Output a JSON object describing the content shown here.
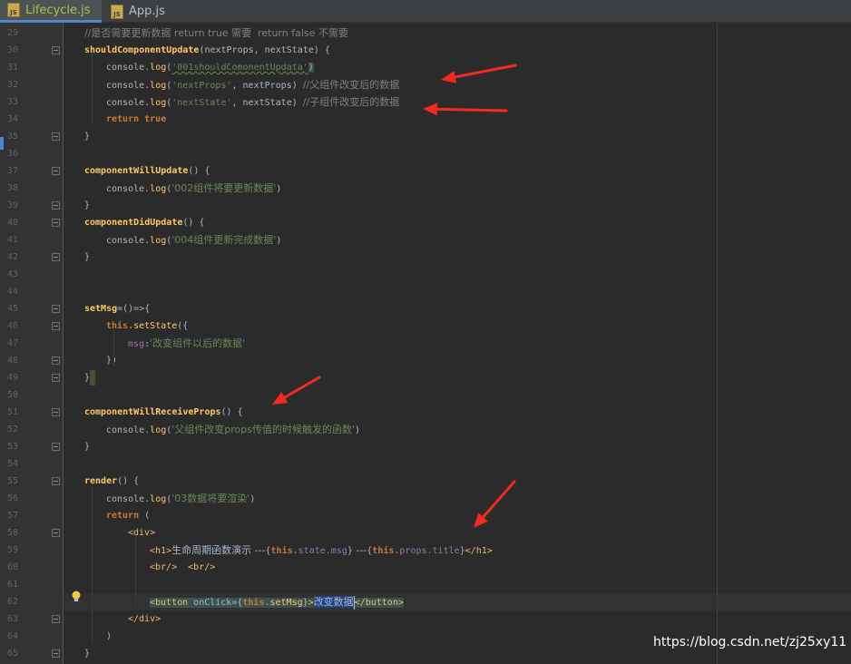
{
  "tabs": [
    {
      "label": "Lifecycle.js",
      "active": true,
      "icon": "js-file-icon"
    },
    {
      "label": "App.js",
      "active": false,
      "icon": "js-file-icon"
    }
  ],
  "code": {
    "line_numbers": [
      "29",
      "30",
      "31",
      "32",
      "33",
      "34",
      "35",
      "36",
      "37",
      "38",
      "39",
      "40",
      "41",
      "42",
      "43",
      "44",
      "45",
      "46",
      "47",
      "48",
      "49",
      "50",
      "51",
      "52",
      "53",
      "54",
      "55",
      "56",
      "57",
      "58",
      "59",
      "60",
      "61",
      "62",
      "63",
      "64",
      "65"
    ],
    "l29": {
      "comment": "//是否需要更新数据 return true 需要  return false 不需要"
    },
    "l30": {
      "name": "shouldComponentUpdate",
      "params": "(nextProps, nextState) {"
    },
    "l31": {
      "obj": "console.",
      "fn": "log",
      "open": "(",
      "str": "'001shouldComonentUpdata'",
      "close": ")"
    },
    "l32": {
      "obj": "console.",
      "fn": "log",
      "open": "(",
      "str": "'nextProps'",
      "rest": ", nextProps) ",
      "comment": "//父组件改变后的数据"
    },
    "l33": {
      "obj": "console.",
      "fn": "log",
      "open": "(",
      "str": "'nextState'",
      "rest": ", nextState) ",
      "comment": "//子组件改变后的数据"
    },
    "l34": {
      "kw": "return true"
    },
    "l35": {
      "text": "}"
    },
    "l37": {
      "name": "componentWillUpdate",
      "params": "() {"
    },
    "l38": {
      "obj": "console.",
      "fn": "log",
      "open": "(",
      "str": "'002组件将要更新数据'",
      "close": ")"
    },
    "l39": {
      "text": "}"
    },
    "l40": {
      "name": "componentDidUpdate",
      "params": "() {"
    },
    "l41": {
      "obj": "console.",
      "fn": "log",
      "open": "(",
      "str": "'004组件更新完成数据'",
      "close": ")"
    },
    "l42": {
      "text": "}"
    },
    "l45": {
      "name": "setMsg",
      "params": "=()=>{"
    },
    "l46": {
      "kw": "this.",
      "fn": "setState",
      "rest": "({"
    },
    "l47": {
      "prop": "msg",
      "colon": ":",
      "str": "'改变组件以后的数据'"
    },
    "l48": {
      "text": "})"
    },
    "l49": {
      "text": "}"
    },
    "l51": {
      "name": "componentWillReceiveProps",
      "params": "() {"
    },
    "l52": {
      "obj": "console.",
      "fn": "log",
      "open": "(",
      "str": "'父组件改变props传值的时候触发的函数'",
      "close": ")"
    },
    "l53": {
      "text": "}"
    },
    "l55": {
      "name": "render",
      "params": "() {"
    },
    "l56": {
      "obj": "console.",
      "fn": "log",
      "open": "(",
      "str": "'03数据将要渲染'",
      "close": ")"
    },
    "l57": {
      "kw": "return",
      "rest": " ("
    },
    "l58": {
      "tag": "<div>"
    },
    "l59": {
      "tag_open": "<h1>",
      "text1": "生命周期函数演示 ---",
      "b1": "{",
      "kw1": "this.",
      "prop1": "state.msg",
      "b2": "}",
      "text2": " ---",
      "b3": "{",
      "kw2": "this.",
      "prop2": "props.title",
      "b4": "}",
      "tag_close": "</h1>"
    },
    "l60": {
      "tag1": "<br/>",
      "sp": "  ",
      "tag2": "<br/>"
    },
    "l62": {
      "tag_open": "<button ",
      "attr": "onClick",
      "eq": "=",
      "b1": "{",
      "kw": "this.",
      "fn": "setMsg",
      "b2": "}",
      "gt": ">",
      "sel": "改变数据",
      "tag_close": "</button>"
    },
    "l63": {
      "tag": "</div>"
    },
    "l64": {
      "text": ")"
    },
    "l65": {
      "text": "}"
    }
  },
  "watermark": "https://blog.csdn.net/zj25xy11",
  "colors": {
    "arrow": "#f02b1f",
    "keyword": "#cc7832",
    "string": "#6a8759",
    "function": "#ffc66d"
  }
}
